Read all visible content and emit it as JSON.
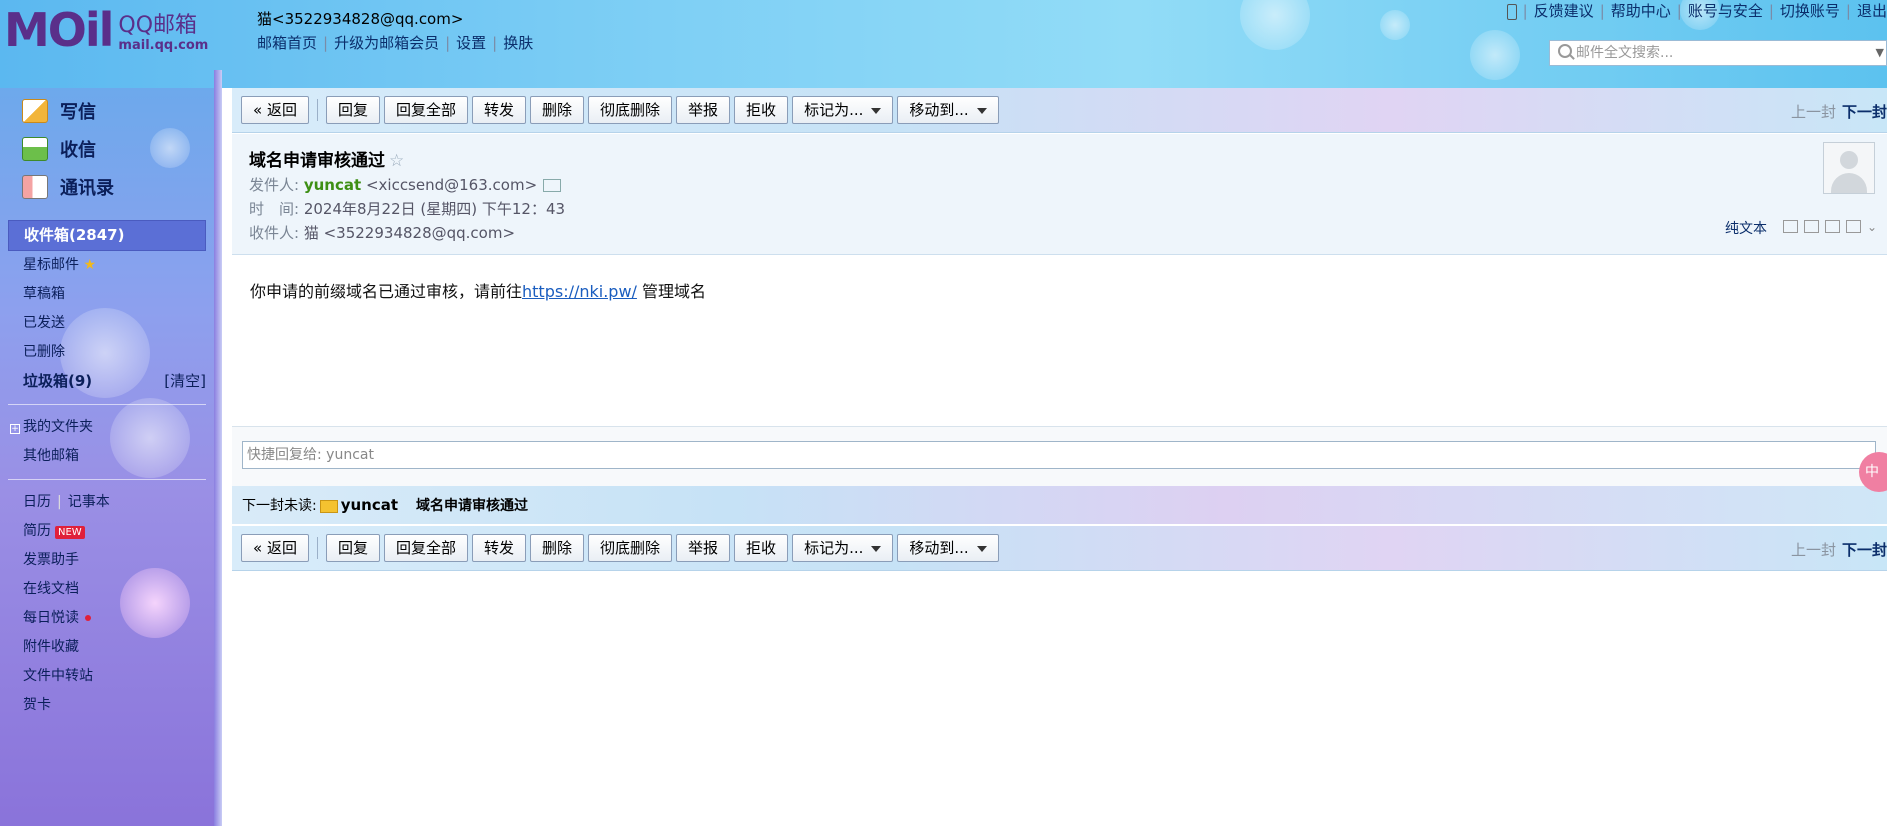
{
  "brand": {
    "logo_main": "MOil",
    "logo_qq": "QQ邮箱",
    "logo_url": "mail.qq.com"
  },
  "user": {
    "display": "猫<3522934828@qq.com>"
  },
  "topnav": [
    "邮箱首页",
    "升级为邮箱会员",
    "设置",
    "换肤"
  ],
  "toplinks": [
    "反馈建议",
    "帮助中心",
    "账号与安全",
    "切换账号",
    "退出"
  ],
  "search": {
    "placeholder": "邮件全文搜索..."
  },
  "quick": [
    {
      "label": "写信",
      "icon": "compose-icon"
    },
    {
      "label": "收信",
      "icon": "receive-icon"
    },
    {
      "label": "通讯录",
      "icon": "contacts-icon"
    }
  ],
  "folders": {
    "inbox": "收件箱(2847)",
    "starred": "星标邮件",
    "drafts": "草稿箱",
    "sent": "已发送",
    "deleted": "已删除",
    "spam": "垃圾箱(9)",
    "spam_clear": "[清空]",
    "my_folders": "我的文件夹",
    "other": "其他邮箱",
    "calendar": "日历",
    "notes": "记事本",
    "resume": "简历",
    "new_badge": "NEW",
    "invoice": "发票助手",
    "docs": "在线文档",
    "daily_read": "每日悦读",
    "attachments": "附件收藏",
    "transfer": "文件中转站",
    "cards": "贺卡"
  },
  "toolbar": {
    "back": "« 返回",
    "reply": "回复",
    "reply_all": "回复全部",
    "forward": "转发",
    "delete": "删除",
    "delete_perm": "彻底删除",
    "report": "举报",
    "reject": "拒收",
    "mark": "标记为...",
    "move": "移动到...",
    "prev": "上一封",
    "next": "下一封"
  },
  "email": {
    "subject": "域名申请审核通过",
    "from_label": "发件人:",
    "from_name": "yuncat",
    "from_addr": "<xiccsend@163.com>",
    "time_label": "时　间:",
    "time": "2024年8月22日 (星期四) 下午12：43",
    "to_label": "收件人:",
    "to": "猫 <3522934828@qq.com>",
    "plain_text": "纯文本",
    "body_pre": "你申请的前缀域名已通过审核，请前往",
    "body_url": "https://nki.pw/",
    "body_post": " 管理域名"
  },
  "quick_reply": {
    "placeholder": "快捷回复给: yuncat"
  },
  "next_unread": {
    "label": "下一封未读:",
    "from": "yuncat",
    "subject": "域名申请审核通过"
  },
  "colors": {
    "accent": "#5b6fd6",
    "sender": "#3d8f14",
    "link": "#1a5dbf"
  }
}
